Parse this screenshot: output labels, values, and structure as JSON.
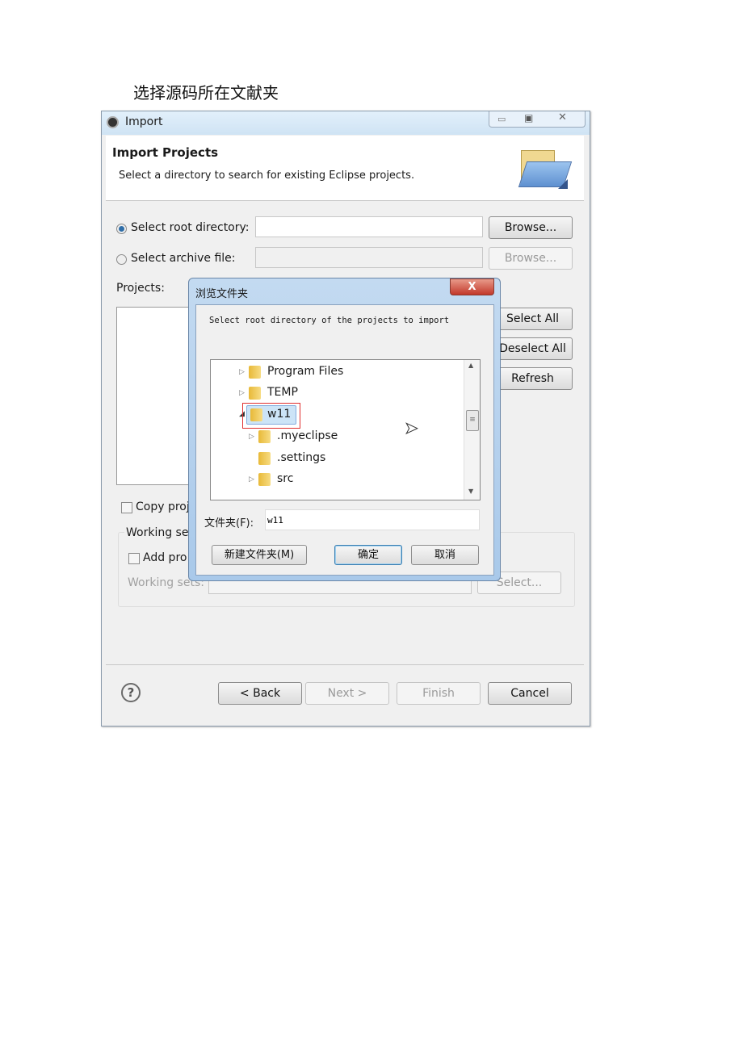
{
  "caption": "选择源码所在文献夹",
  "window": {
    "title": "Import",
    "header_title": "Import Projects",
    "header_desc": "Select a directory to search for existing Eclipse projects.",
    "root_dir_label": "Select root directory:",
    "root_dir_value": "",
    "archive_label": "Select archive file:",
    "browse": "Browse...",
    "projects_label": "Projects:",
    "select_all": "Select All",
    "deselect_all": "Deselect All",
    "refresh": "Refresh",
    "copy_label": "Copy proj",
    "working_sets_group": "Working se",
    "add_label": "Add pro",
    "working_sets_label": "Working sets:",
    "select_btn": "Select...",
    "back": "< Back",
    "next": "Next >",
    "finish": "Finish",
    "cancel": "Cancel"
  },
  "browse_dialog": {
    "title": "浏览文件夹",
    "close": "X",
    "instruction": "Select root directory of the projects to import",
    "tree": [
      {
        "label": "Program Files",
        "expanded": false,
        "level": 0
      },
      {
        "label": "TEMP",
        "expanded": false,
        "level": 0
      },
      {
        "label": "w11",
        "expanded": true,
        "level": 0,
        "selected": true
      },
      {
        "label": ".myeclipse",
        "expanded": false,
        "level": 1
      },
      {
        "label": ".settings",
        "expanded": null,
        "level": 1
      },
      {
        "label": "src",
        "expanded": false,
        "level": 1
      }
    ],
    "folder_label": "文件夹(F):",
    "folder_value": "w11",
    "new_folder": "新建文件夹(M)",
    "ok": "确定",
    "cancel": "取消"
  },
  "colors": {
    "highlight_box": "#e03030",
    "selection": "#cce4f7",
    "title_bar": "#d6e8f7"
  }
}
